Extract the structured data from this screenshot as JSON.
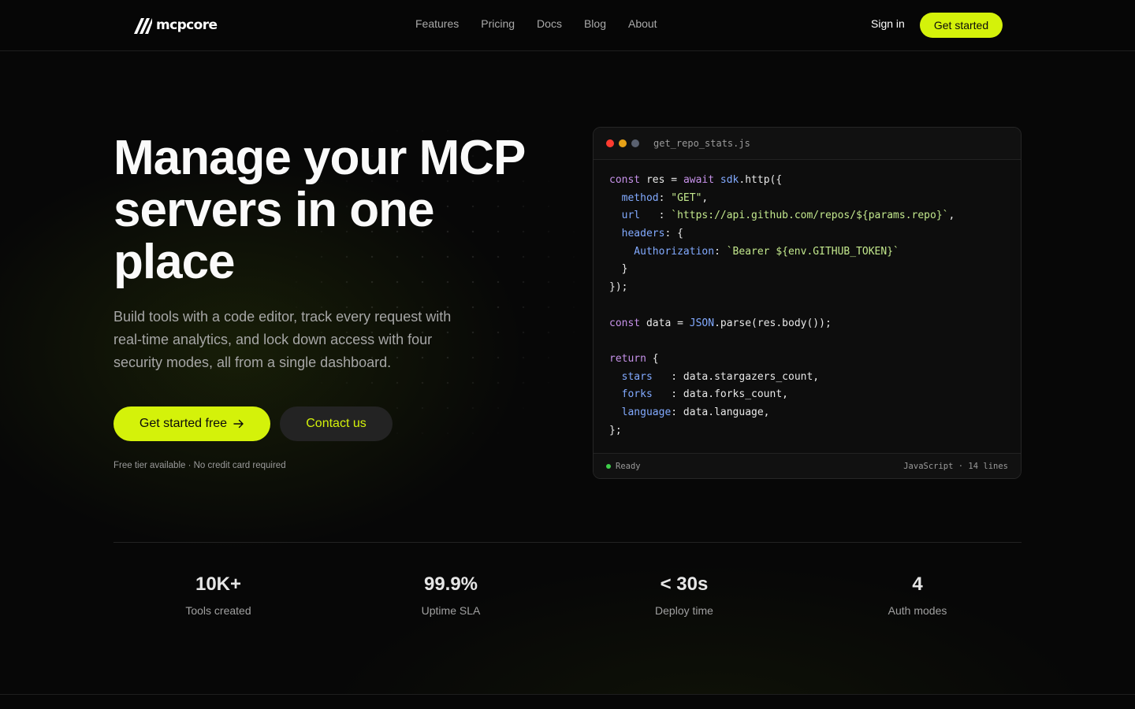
{
  "brand": {
    "name": "mcpcore",
    "accent": "#d4f20a"
  },
  "nav": {
    "links": [
      "Features",
      "Pricing",
      "Docs",
      "Blog",
      "About"
    ],
    "signin": "Sign in",
    "cta": "Get started"
  },
  "hero": {
    "headline": "Manage your MCP servers in one place",
    "subtext": "Build tools with a code editor, track every request with real-time analytics, and lock down access with four security modes, all from a single dashboard.",
    "primary_cta": "Get started free",
    "secondary_cta": "Contact us",
    "note": "Free tier available · No credit card required"
  },
  "editor": {
    "filename": "get_repo_stats.js",
    "lines": [
      [
        [
          "const ",
          "k"
        ],
        [
          "res = ",
          ""
        ],
        [
          "await ",
          "k"
        ],
        [
          "sdk",
          "p"
        ],
        [
          ".http({",
          ""
        ]
      ],
      [
        [
          "  method",
          "p"
        ],
        [
          ": ",
          ""
        ],
        [
          "\"GET\"",
          "s"
        ],
        [
          ",",
          ""
        ]
      ],
      [
        [
          "  url   ",
          "p"
        ],
        [
          ": ",
          ""
        ],
        [
          "`https://api.github.com/repos/${params.repo}`",
          "s"
        ],
        [
          ",",
          ""
        ]
      ],
      [
        [
          "  headers",
          "p"
        ],
        [
          ": {",
          ""
        ]
      ],
      [
        [
          "    Authorization",
          "p"
        ],
        [
          ": ",
          ""
        ],
        [
          "`Bearer ${env.GITHUB_TOKEN}`",
          "s"
        ]
      ],
      [
        [
          "  }",
          ""
        ]
      ],
      [
        [
          "});",
          ""
        ]
      ],
      [
        [
          "",
          ""
        ]
      ],
      [
        [
          "const ",
          "k"
        ],
        [
          "data = ",
          ""
        ],
        [
          "JSON",
          "p"
        ],
        [
          ".parse(res.body());",
          ""
        ]
      ],
      [
        [
          "",
          ""
        ]
      ],
      [
        [
          "return ",
          "k"
        ],
        [
          "{",
          ""
        ]
      ],
      [
        [
          "  stars   ",
          "p"
        ],
        [
          ": data.stargazers_count,",
          ""
        ]
      ],
      [
        [
          "  forks   ",
          "p"
        ],
        [
          ": data.forks_count,",
          ""
        ]
      ],
      [
        [
          "  language",
          "p"
        ],
        [
          ": data.language,",
          ""
        ]
      ],
      [
        [
          "};",
          ""
        ]
      ]
    ],
    "status": "Ready",
    "meta": "JavaScript · 14 lines"
  },
  "stats": [
    {
      "value": "10K+",
      "label": "Tools created"
    },
    {
      "value": "99.9%",
      "label": "Uptime SLA"
    },
    {
      "value": "< 30s",
      "label": "Deploy time"
    },
    {
      "value": "4",
      "label": "Auth modes"
    }
  ]
}
